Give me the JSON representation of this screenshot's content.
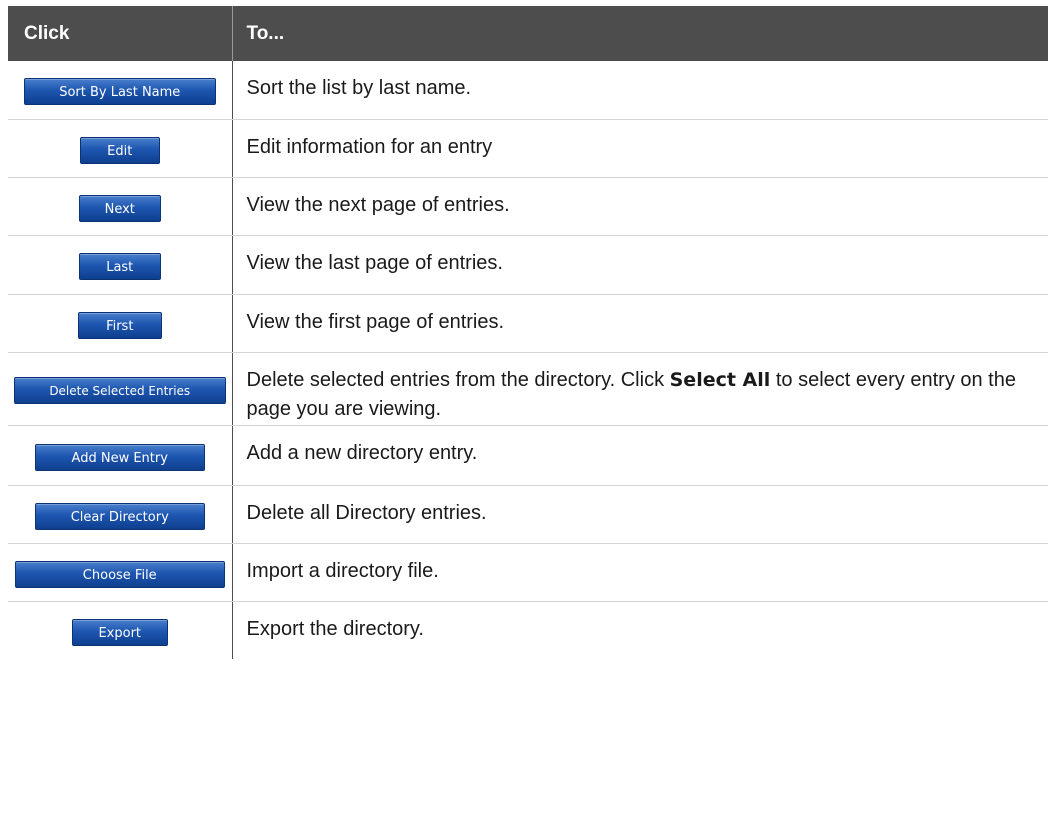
{
  "header": {
    "col_click": "Click",
    "col_to": "To..."
  },
  "rows": [
    {
      "button": "Sort By Last Name",
      "description": "Sort the list by last name."
    },
    {
      "button": "Edit",
      "description": "Edit information for an entry"
    },
    {
      "button": "Next",
      "description": "View the next page of entries."
    },
    {
      "button": "Last",
      "description": "View the last page of entries."
    },
    {
      "button": "First",
      "description": "View the first page of entries."
    },
    {
      "button": "Delete Selected Entries",
      "description_part1": "Delete selected entries from the directory. Click ",
      "description_bold": "Select All",
      "description_part2": " to select every entry on the page you are viewing."
    },
    {
      "button": "Add New Entry",
      "description": "Add a new directory entry."
    },
    {
      "button": "Clear Directory",
      "description": "Delete all Directory entries."
    },
    {
      "button": "Choose File",
      "description": "Import a directory file."
    },
    {
      "button": "Export",
      "description": "Export the directory."
    }
  ],
  "colors": {
    "header_bg": "#4d4d4d",
    "button_blue": "#1d56b0"
  }
}
